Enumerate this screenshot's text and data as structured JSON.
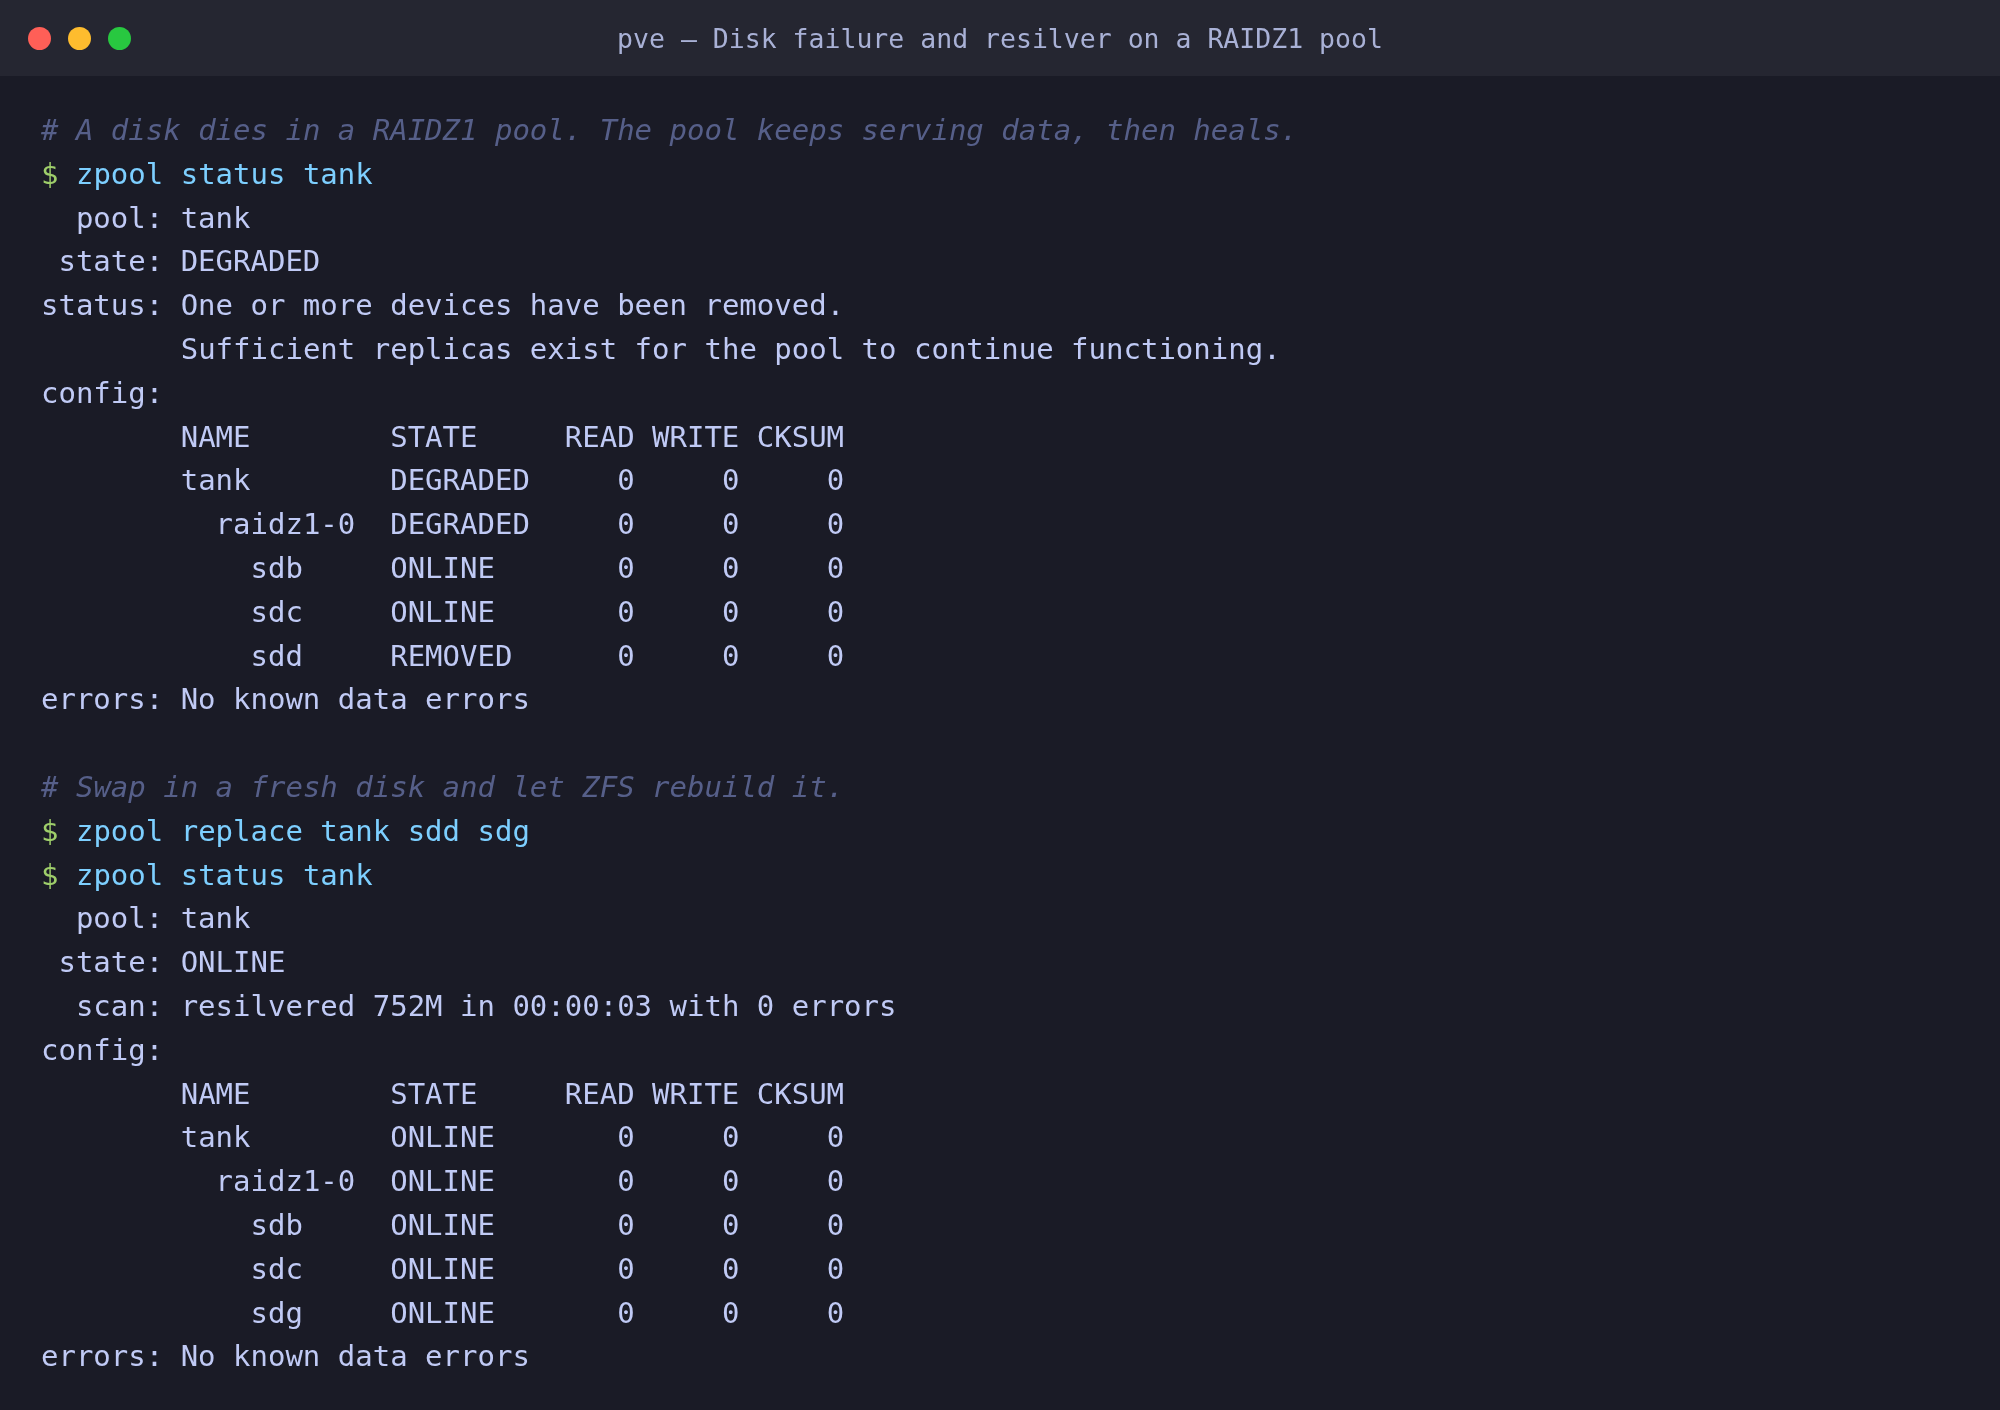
{
  "window": {
    "title": "pve — Disk failure and resilver on a RAIDZ1 pool"
  },
  "lines": [
    {
      "kind": "comment",
      "text": "# A disk dies in a RAIDZ1 pool. The pool keeps serving data, then heals."
    },
    {
      "kind": "command",
      "prompt": "$",
      "text": "zpool status tank"
    },
    {
      "kind": "field",
      "label": "pool:",
      "value": "tank"
    },
    {
      "kind": "field",
      "label": "state:",
      "value": "DEGRADED"
    },
    {
      "kind": "field",
      "label": "status:",
      "value": "One or more devices have been removed."
    },
    {
      "kind": "continuation",
      "text": "Sufficient replicas exist for the pool to continue functioning."
    },
    {
      "kind": "field",
      "label": "config:"
    },
    {
      "kind": "vdev_table",
      "columns": [
        "NAME",
        "STATE",
        "READ",
        "WRITE",
        "CKSUM"
      ],
      "rows": [
        {
          "name": "tank",
          "state": "DEGRADED",
          "read": "0",
          "write": "0",
          "cksum": "0",
          "children": [
            {
              "name": "raidz1-0",
              "state": "DEGRADED",
              "read": "0",
              "write": "0",
              "cksum": "0",
              "children": [
                {
                  "name": "sdb",
                  "state": "ONLINE",
                  "read": "0",
                  "write": "0",
                  "cksum": "0"
                },
                {
                  "name": "sdc",
                  "state": "ONLINE",
                  "read": "0",
                  "write": "0",
                  "cksum": "0"
                },
                {
                  "name": "sdd",
                  "state": "REMOVED",
                  "read": "0",
                  "write": "0",
                  "cksum": "0"
                }
              ]
            }
          ]
        }
      ]
    },
    {
      "kind": "field",
      "label": "errors:",
      "value": "No known data errors"
    },
    {
      "kind": "blank"
    },
    {
      "kind": "comment",
      "text": "# Swap in a fresh disk and let ZFS rebuild it."
    },
    {
      "kind": "command",
      "prompt": "$",
      "text": "zpool replace tank sdd sdg"
    },
    {
      "kind": "command",
      "prompt": "$",
      "text": "zpool status tank"
    },
    {
      "kind": "field",
      "label": "pool:",
      "value": "tank"
    },
    {
      "kind": "field",
      "label": "state:",
      "value": "ONLINE"
    },
    {
      "kind": "field",
      "label": "scan:",
      "value": "resilvered 752M in 00:00:03 with 0 errors"
    },
    {
      "kind": "field",
      "label": "config:"
    },
    {
      "kind": "vdev_table",
      "columns": [
        "NAME",
        "STATE",
        "READ",
        "WRITE",
        "CKSUM"
      ],
      "rows": [
        {
          "name": "tank",
          "state": "ONLINE",
          "read": "0",
          "write": "0",
          "cksum": "0",
          "children": [
            {
              "name": "raidz1-0",
              "state": "ONLINE",
              "read": "0",
              "write": "0",
              "cksum": "0",
              "children": [
                {
                  "name": "sdb",
                  "state": "ONLINE",
                  "read": "0",
                  "write": "0",
                  "cksum": "0"
                },
                {
                  "name": "sdc",
                  "state": "ONLINE",
                  "read": "0",
                  "write": "0",
                  "cksum": "0"
                },
                {
                  "name": "sdg",
                  "state": "ONLINE",
                  "read": "0",
                  "write": "0",
                  "cksum": "0"
                }
              ]
            }
          ]
        }
      ]
    },
    {
      "kind": "field",
      "label": "errors:",
      "value": "No known data errors"
    }
  ]
}
